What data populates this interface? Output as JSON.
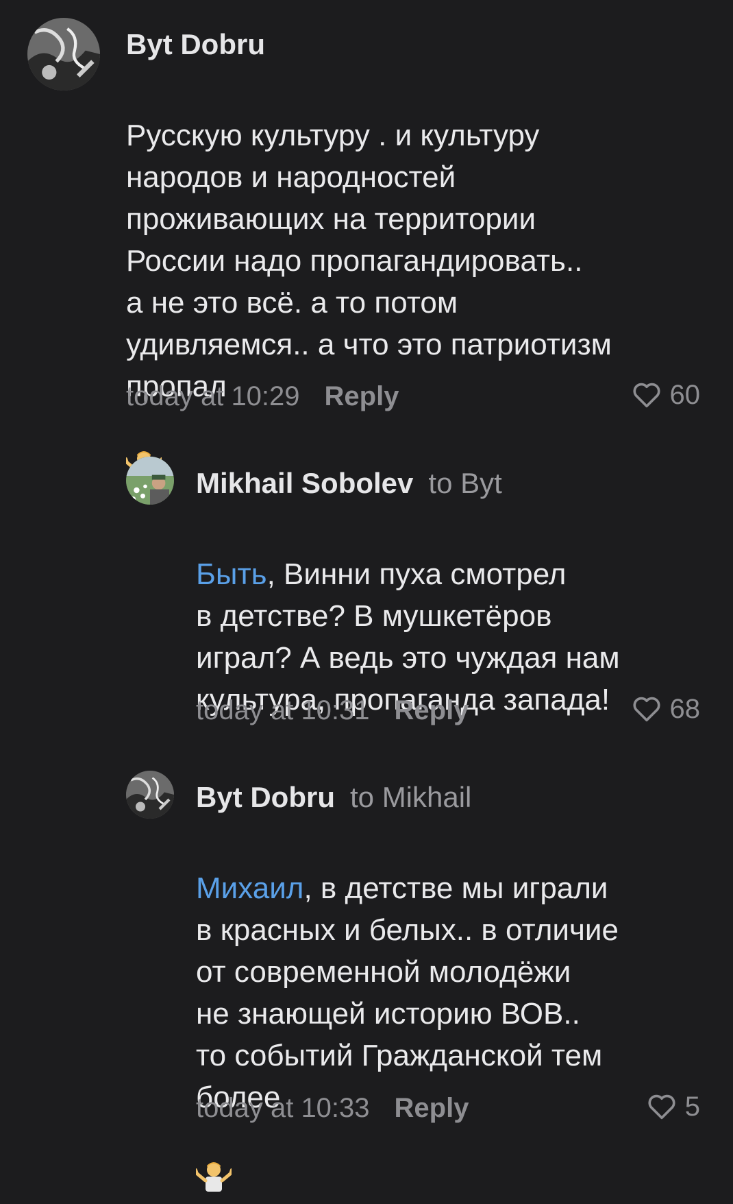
{
  "comments": [
    {
      "author": "Byt Dobru",
      "to": "",
      "mention": "",
      "text": "Русскую культуру . и  культуру\nнародов и народностей\nпроживающих на территории\nРоссии надо пропагандировать..\nа не это всё. а то потом\nудивляемся.. а что это патриотизм\nпропал",
      "time": "today at 10:29",
      "reply_label": "Reply",
      "likes": "60",
      "emoji": "person-shrugging"
    },
    {
      "author": "Mikhail Sobolev",
      "to": "to Byt",
      "mention": "Быть",
      "text": ", Винни пуха смотрел\nв детстве? В мушкетёров\nиграл? А ведь это чуждая нам\nкультура, пропаганда запада!",
      "time": "today at 10:31",
      "reply_label": "Reply",
      "likes": "68",
      "emoji": ""
    },
    {
      "author": "Byt Dobru",
      "to": "to Mikhail",
      "mention": "Михаил",
      "text": ", в детстве мы играли\nв красных и белых.. в отличие\nот современной молодёжи\nне знающей историю ВОВ..\nто событий Гражданской тем\nболее",
      "time": "today at 10:33",
      "reply_label": "Reply",
      "likes": "5",
      "emoji": "person-shrugging"
    }
  ],
  "colors": {
    "background": "#1c1c1e",
    "mention": "#5aa0e8",
    "meta": "#8e8e92"
  }
}
